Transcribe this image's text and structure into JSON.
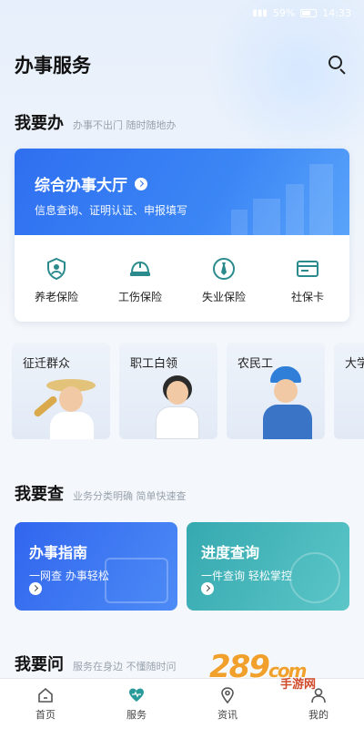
{
  "status_bar": {
    "battery": "59%",
    "time": "14:33"
  },
  "header": {
    "title": "办事服务"
  },
  "sections": {
    "do": {
      "title": "我要办",
      "subtitle": "办事不出门 随时随地办"
    },
    "check": {
      "title": "我要查",
      "subtitle": "业务分类明确 简单快速查"
    },
    "ask": {
      "title": "我要问",
      "subtitle": "服务在身边 不懂随时问"
    }
  },
  "hall": {
    "title": "综合办事大厅",
    "subtitle": "信息查询、证明认证、申报填写"
  },
  "services": [
    {
      "label": "养老保险",
      "icon": "pension-shield-icon"
    },
    {
      "label": "工伤保险",
      "icon": "hardhat-icon"
    },
    {
      "label": "失业保险",
      "icon": "tie-icon"
    },
    {
      "label": "社保卡",
      "icon": "card-icon"
    }
  ],
  "groups": [
    {
      "label": "征迁群众"
    },
    {
      "label": "职工白领"
    },
    {
      "label": "农民工"
    },
    {
      "label": "大学"
    }
  ],
  "query_cards": [
    {
      "title": "办事指南",
      "subtitle": "一网查 办事轻松",
      "color": "#3d78f2"
    },
    {
      "title": "进度查询",
      "subtitle": "一件查询 轻松掌控",
      "color": "#3bb3b8"
    }
  ],
  "tabs": [
    {
      "label": "首页",
      "icon": "home-icon"
    },
    {
      "label": "服务",
      "icon": "heart-icon"
    },
    {
      "label": "资讯",
      "icon": "location-pin-icon"
    },
    {
      "label": "我的",
      "icon": "user-icon"
    }
  ],
  "watermark": {
    "number": "289",
    "suffix": "com",
    "text": "手游网"
  },
  "colors": {
    "primary": "#2f6ff0",
    "teal": "#3bb3b8",
    "accent_icon": "#2a8a8c"
  }
}
